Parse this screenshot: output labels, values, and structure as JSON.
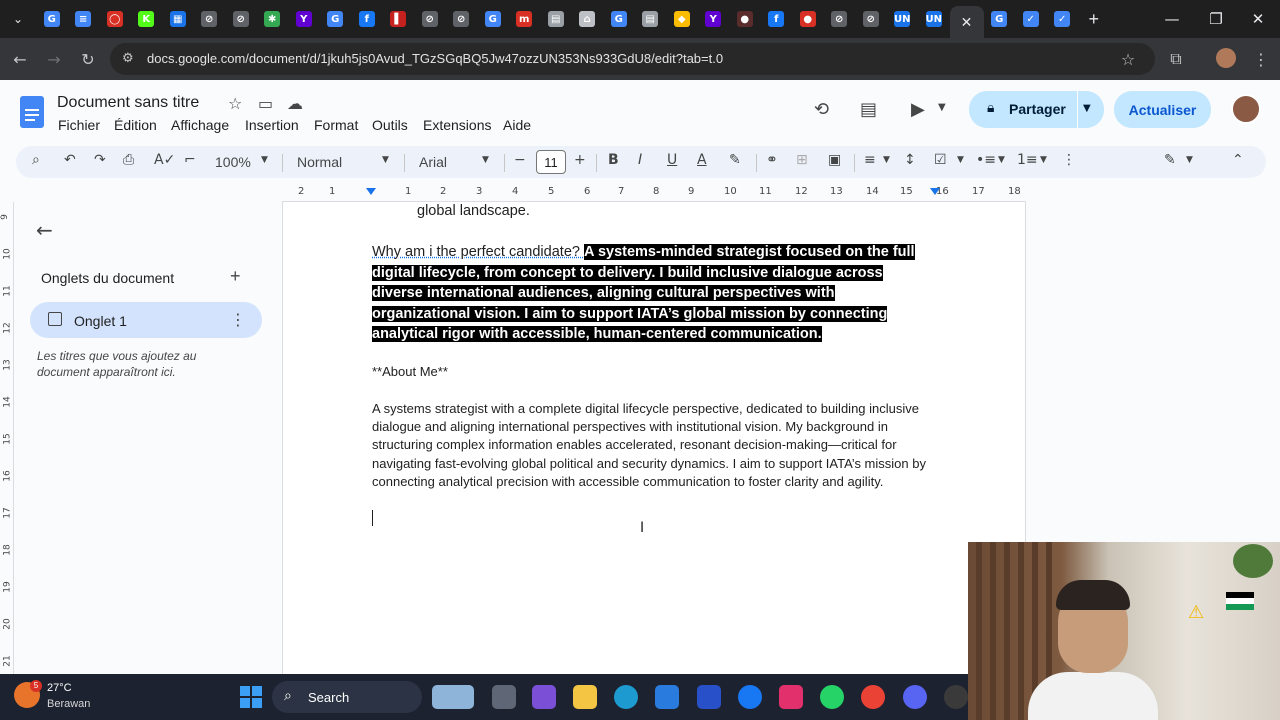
{
  "browser": {
    "url": "docs.google.com/document/d/1jkuh5js0Avud_TGzSGqBQ5Jw47ozzUN353Ns933GdU8/edit?tab=t.0",
    "tab_favicons": [
      {
        "name": "google",
        "color": "#4285f4",
        "glyph": "G"
      },
      {
        "name": "docs",
        "color": "#4285f4",
        "glyph": "≡"
      },
      {
        "name": "red-circle",
        "color": "#d93025",
        "glyph": "◯"
      },
      {
        "name": "kick",
        "color": "#53fc18",
        "glyph": "K"
      },
      {
        "name": "grid",
        "color": "#1a73e8",
        "glyph": "▦"
      },
      {
        "name": "globe",
        "color": "#5f6368",
        "glyph": "⊘"
      },
      {
        "name": "globe",
        "color": "#5f6368",
        "glyph": "⊘"
      },
      {
        "name": "puzzle",
        "color": "#34a853",
        "glyph": "✱"
      },
      {
        "name": "yahoo",
        "color": "#6001d2",
        "glyph": "Y"
      },
      {
        "name": "google",
        "color": "#4285f4",
        "glyph": "G"
      },
      {
        "name": "facebook",
        "color": "#1877f2",
        "glyph": "f"
      },
      {
        "name": "ad",
        "color": "#c5221f",
        "glyph": "▌"
      },
      {
        "name": "globe",
        "color": "#5f6368",
        "glyph": "⊘"
      },
      {
        "name": "globe",
        "color": "#5f6368",
        "glyph": "⊘"
      },
      {
        "name": "google",
        "color": "#4285f4",
        "glyph": "G"
      },
      {
        "name": "m",
        "color": "#d93025",
        "glyph": "m"
      },
      {
        "name": "newspaper",
        "color": "#9aa0a6",
        "glyph": "▤"
      },
      {
        "name": "arch",
        "color": "#bdc1c6",
        "glyph": "⌂"
      },
      {
        "name": "google",
        "color": "#4285f4",
        "glyph": "G"
      },
      {
        "name": "list",
        "color": "#9aa0a6",
        "glyph": "▤"
      },
      {
        "name": "leaf",
        "color": "#fbbc04",
        "glyph": "◆"
      },
      {
        "name": "yahoo",
        "color": "#6001d2",
        "glyph": "Y"
      },
      {
        "name": "dark",
        "color": "#5b2c2c",
        "glyph": "●"
      },
      {
        "name": "facebook",
        "color": "#1877f2",
        "glyph": "f"
      },
      {
        "name": "red",
        "color": "#d93025",
        "glyph": "●"
      },
      {
        "name": "globe",
        "color": "#5f6368",
        "glyph": "⊘"
      },
      {
        "name": "globe",
        "color": "#5f6368",
        "glyph": "⊘"
      },
      {
        "name": "un",
        "color": "#1a73e8",
        "glyph": "UN"
      },
      {
        "name": "un",
        "color": "#1a73e8",
        "glyph": "UN"
      }
    ],
    "after_active": [
      {
        "name": "google",
        "color": "#4285f4",
        "glyph": "G"
      },
      {
        "name": "check",
        "color": "#4285f4",
        "glyph": "✓"
      },
      {
        "name": "check",
        "color": "#4285f4",
        "glyph": "✓"
      }
    ],
    "close_glyph": "✕",
    "new_tab_glyph": "+"
  },
  "docs": {
    "title": "Document sans titre",
    "menu": [
      "Fichier",
      "Édition",
      "Affichage",
      "Insertion",
      "Format",
      "Outils",
      "Extensions",
      "Aide"
    ],
    "share_label": "Partager",
    "update_label": "Actualiser",
    "toolbar": {
      "zoom": "100%",
      "style": "Normal",
      "font": "Arial",
      "font_size": "11"
    }
  },
  "ruler": {
    "numbers": [
      "2",
      "1",
      "1",
      "2",
      "3",
      "4",
      "5",
      "6",
      "7",
      "8",
      "9",
      "10",
      "11",
      "12",
      "13",
      "14",
      "15",
      "16",
      "17",
      "18"
    ],
    "vertical": [
      "9",
      "10",
      "11",
      "12",
      "13",
      "14",
      "15",
      "16",
      "17",
      "18",
      "19",
      "20",
      "21"
    ]
  },
  "sidebar": {
    "heading": "Onglets du document",
    "add_glyph": "+",
    "tab_label": "Onglet 1",
    "hint": "Les titres que vous ajoutez au document apparaîtront ici."
  },
  "document": {
    "top_line": "global landscape.",
    "question": "Why am i the perfect candidate? ",
    "highlighted": "A systems-minded strategist focused on the full digital lifecycle, from concept to delivery. I build inclusive dialogue across diverse international audiences, aligning cultural perspectives with organizational vision. I aim to support IATA’s global mission by connecting analytical rigor with accessible, human-centered communication.",
    "about_heading": "**About Me**",
    "about_body": "A systems strategist with a complete digital lifecycle perspective, dedicated to building inclusive dialogue and aligning international perspectives with institutional vision. My background in structuring complex information enables accelerated, resonant decision-making—critical for navigating fast-evolving global political and security dynamics. I aim to support IATA’s mission by connecting analytical precision with accessible communication to foster clarity and agility."
  },
  "taskbar": {
    "temperature": "27°C",
    "weather": "Berawan",
    "badge": "5",
    "search_label": "Search"
  }
}
